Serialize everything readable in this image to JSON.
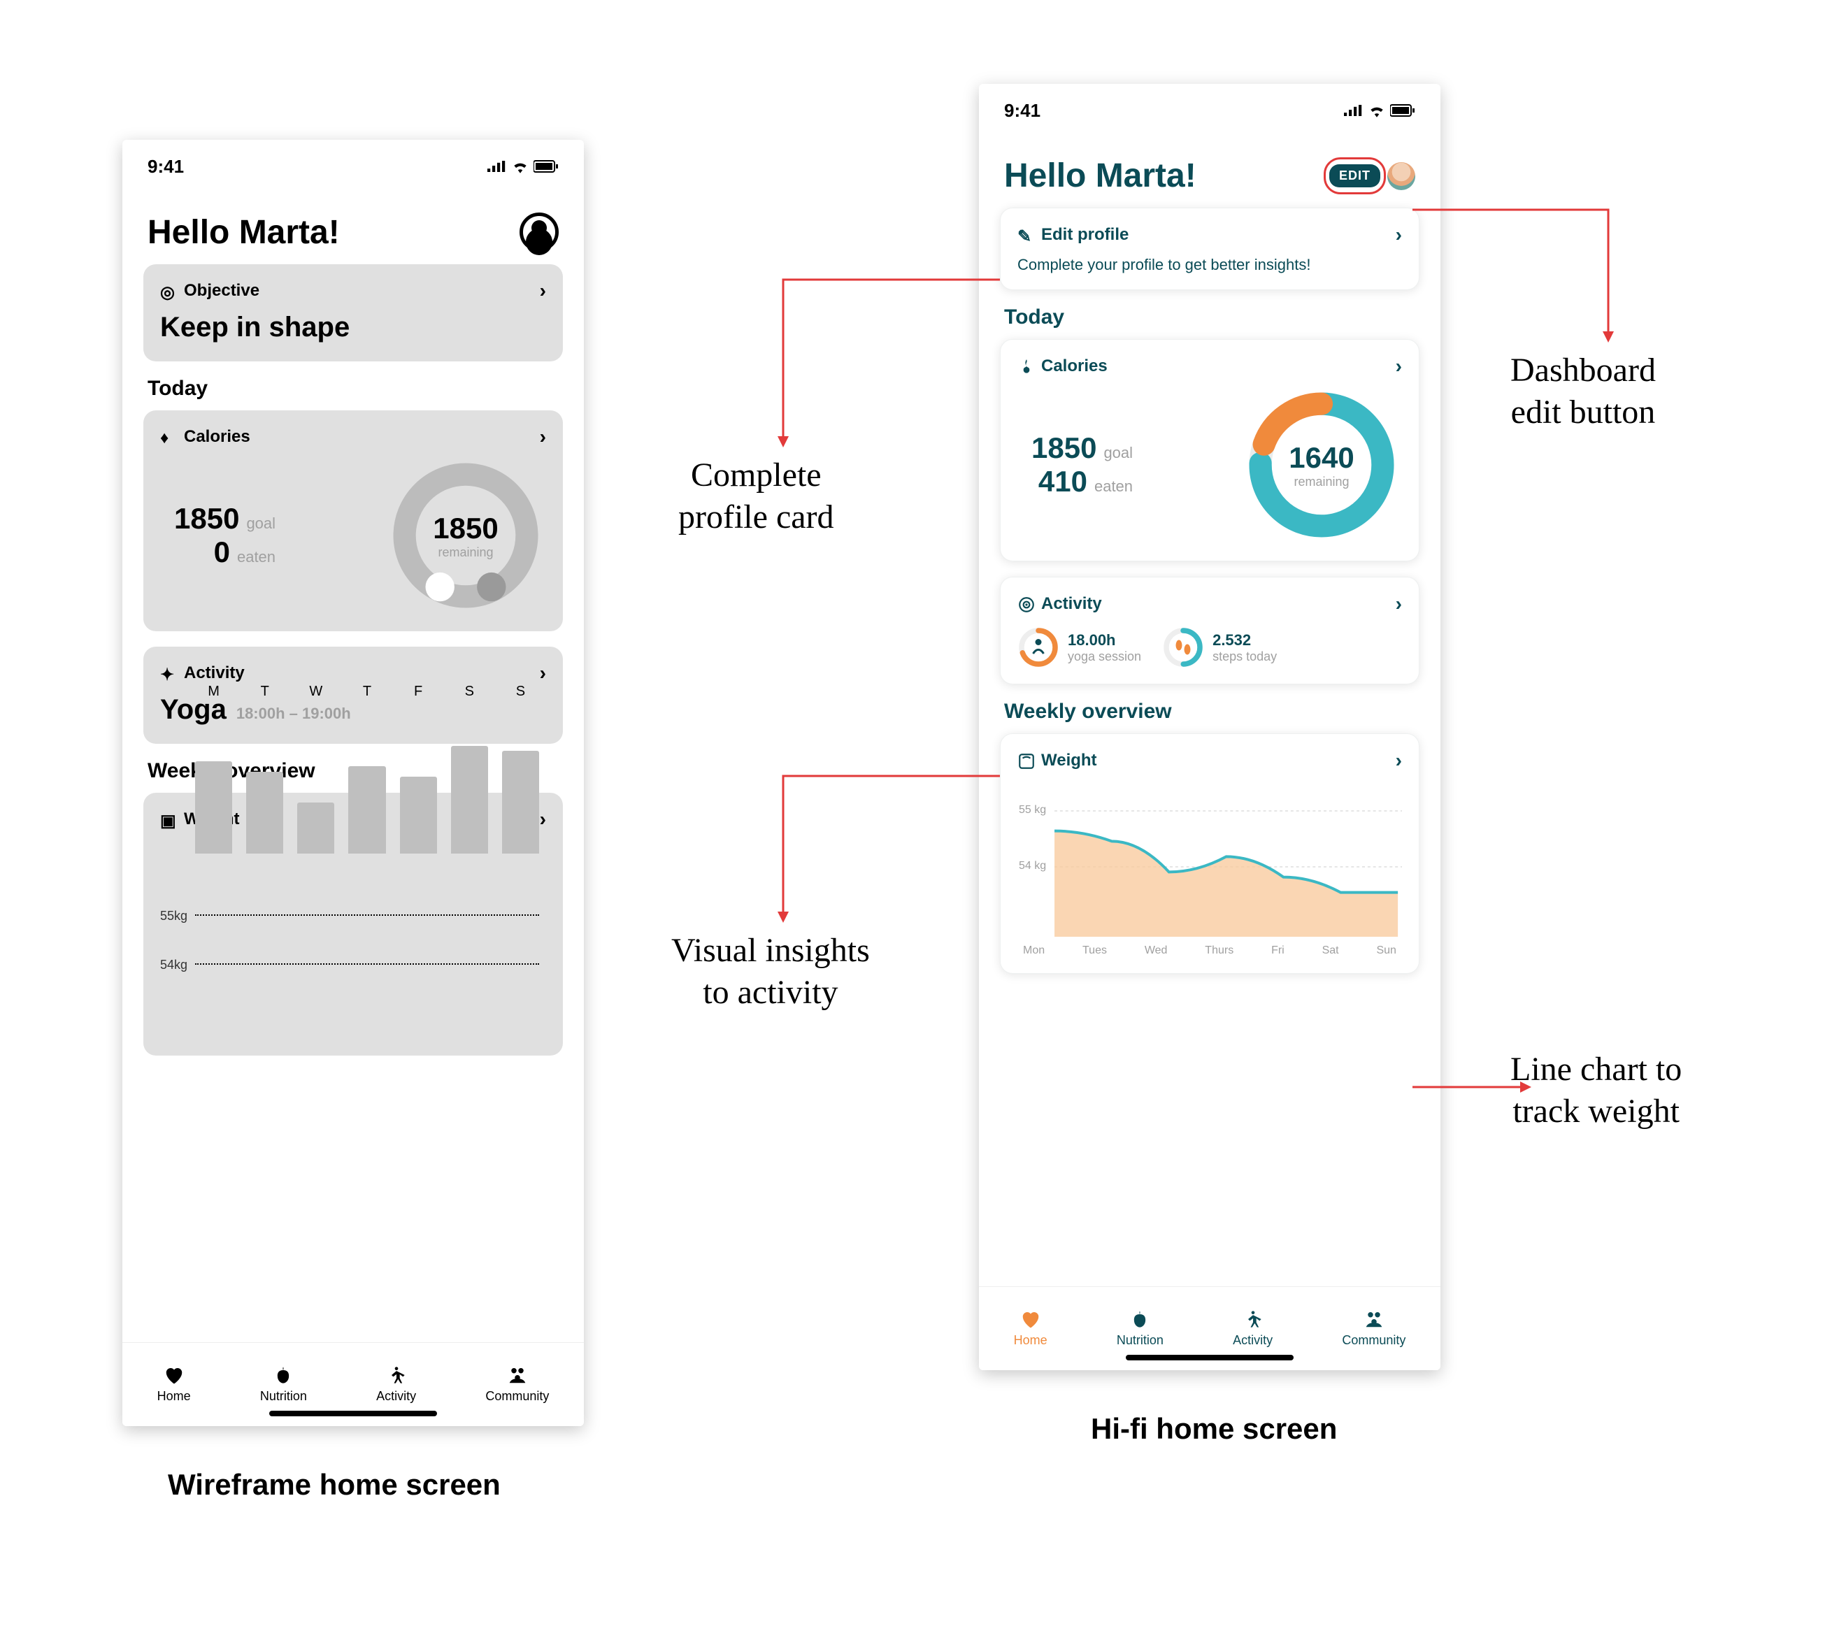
{
  "status": {
    "time": "9:41"
  },
  "wire": {
    "greeting": "Hello Marta!",
    "objective": {
      "title": "Objective",
      "value": "Keep in shape"
    },
    "today_label": "Today",
    "calories": {
      "title": "Calories",
      "goal": 1850,
      "goal_label": "goal",
      "eaten": 0,
      "eaten_label": "eaten",
      "remaining": 1850,
      "remaining_label": "remaining"
    },
    "activity": {
      "title": "Activity",
      "value": "Yoga",
      "time": "18:00h – 19:00h"
    },
    "weekly_label": "Weekly overview",
    "weight": {
      "title": "Weight"
    },
    "nav": [
      "Home",
      "Nutrition",
      "Activity",
      "Community"
    ]
  },
  "hifi": {
    "greeting": "Hello Marta!",
    "edit_label": "EDIT",
    "profile_card": {
      "title": "Edit profile",
      "subtitle": "Complete your profile to get better insights!"
    },
    "today_label": "Today",
    "calories": {
      "title": "Calories",
      "goal": 1850,
      "goal_label": "goal",
      "eaten": 410,
      "eaten_label": "eaten",
      "remaining": 1640,
      "remaining_label": "remaining"
    },
    "activity": {
      "title": "Activity",
      "yoga_time": "18.00h",
      "yoga_label": "yoga session",
      "steps": "2.532",
      "steps_label": "steps today"
    },
    "weekly_label": "Weekly overview",
    "weight": {
      "title": "Weight",
      "axis55": "55 kg",
      "axis54": "54 kg"
    },
    "nav": [
      "Home",
      "Nutrition",
      "Activity",
      "Community"
    ]
  },
  "captions": {
    "wire": "Wireframe home screen",
    "hifi": "Hi-fi home screen"
  },
  "annotations": {
    "profile_card": "Complete\nprofile card",
    "edit_button": "Dashboard\nedit button",
    "activity": "Visual insights\nto activity",
    "weight": "Line chart to\ntrack weight"
  },
  "chart_data": [
    {
      "type": "bar",
      "name": "wireframe-weight",
      "categories": [
        "M",
        "T",
        "W",
        "T",
        "F",
        "S",
        "S"
      ],
      "values": [
        54.8,
        54.6,
        54.0,
        54.7,
        54.5,
        55.1,
        55.0
      ],
      "ylim": [
        53,
        56
      ],
      "gridlines": [
        54,
        55
      ],
      "ylabel": "kg"
    },
    {
      "type": "line",
      "name": "hifi-weight",
      "categories": [
        "Mon",
        "Tues",
        "Wed",
        "Thurs",
        "Fri",
        "Sat",
        "Sun"
      ],
      "values": [
        55.2,
        55.0,
        54.4,
        54.7,
        54.3,
        54.0,
        54.0
      ],
      "ylim": [
        53,
        56
      ],
      "gridlines": [
        54,
        55
      ],
      "ylabel": "kg"
    },
    {
      "type": "pie",
      "name": "wireframe-calories-donut",
      "values": {
        "eaten": 0,
        "remaining": 1850
      },
      "total": 1850
    },
    {
      "type": "pie",
      "name": "hifi-calories-donut",
      "values": {
        "eaten": 410,
        "remaining": 1640
      },
      "total": 2050
    }
  ]
}
